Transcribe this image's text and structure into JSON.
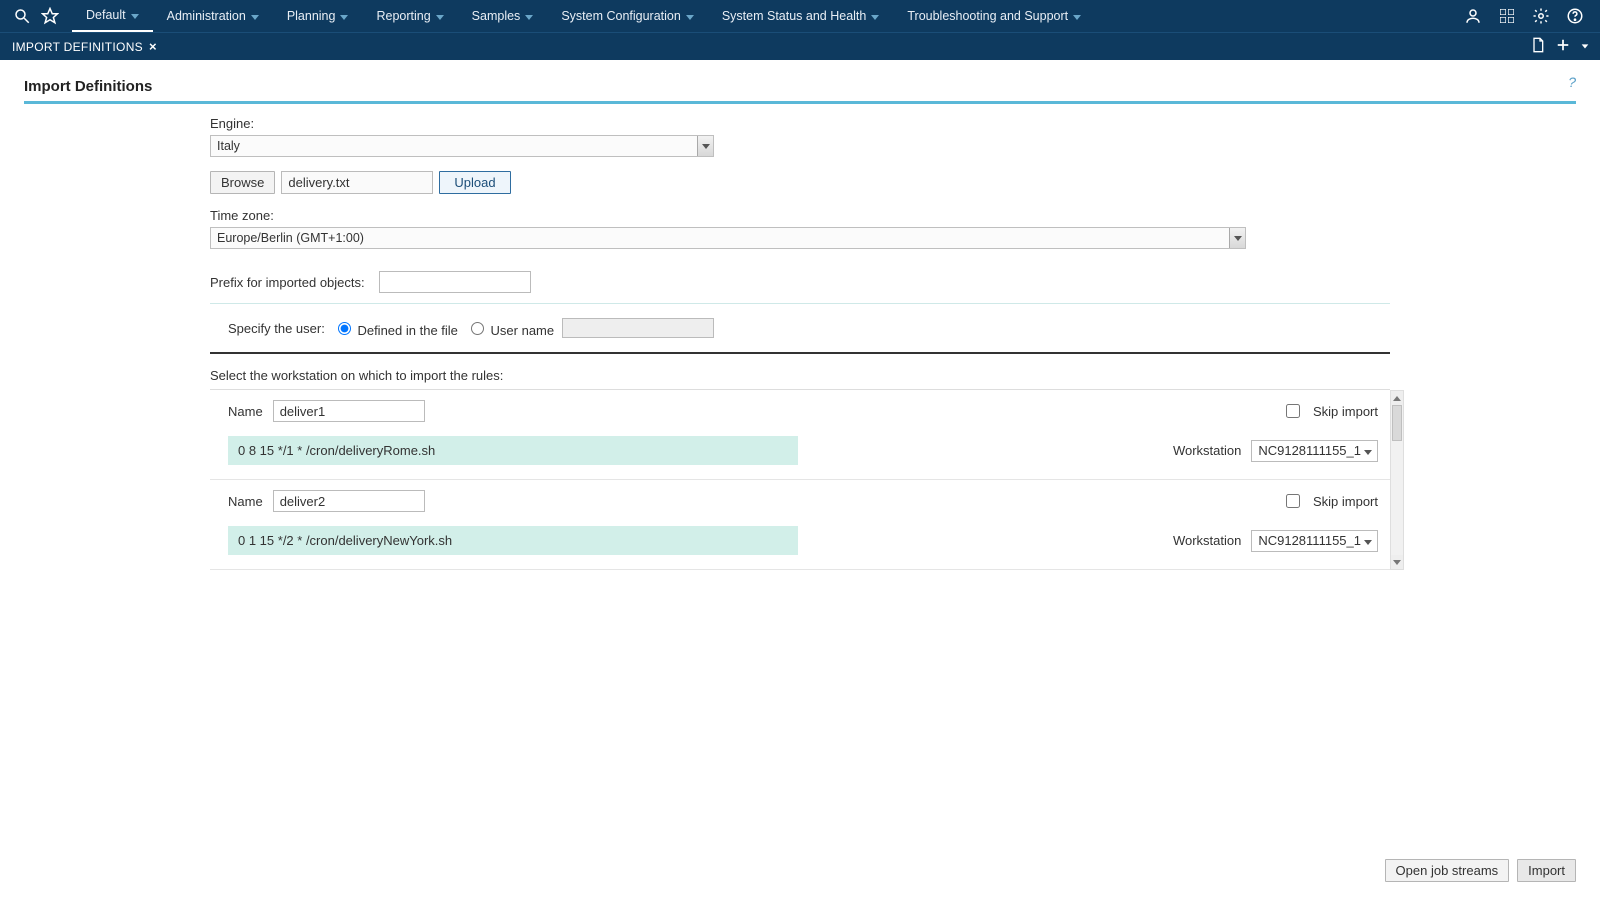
{
  "nav": {
    "menus": [
      "Default",
      "Administration",
      "Planning",
      "Reporting",
      "Samples",
      "System Configuration",
      "System Status and Health",
      "Troubleshooting and Support"
    ]
  },
  "tab": {
    "title": "IMPORT DEFINITIONS"
  },
  "page": {
    "title": "Import Definitions",
    "help": "?"
  },
  "form": {
    "engine_label": "Engine:",
    "engine_value": "Italy",
    "browse_label": "Browse",
    "file_name": "delivery.txt",
    "upload_label": "Upload",
    "timezone_label": "Time zone:",
    "timezone_value": "Europe/Berlin (GMT+1:00)",
    "prefix_label": "Prefix for imported objects:",
    "prefix_value": "",
    "specify_user_label": "Specify the user:",
    "radio_defined": "Defined in the file",
    "radio_username": "User name",
    "username_value": ""
  },
  "rules": {
    "header": "Select the workstation on which to import the rules:",
    "name_label": "Name",
    "skip_label": "Skip import",
    "workstation_label": "Workstation",
    "items": [
      {
        "name": "deliver1",
        "cron": "0 8 15 */1 * /cron/deliveryRome.sh",
        "skip": false,
        "workstation": "NC9128111155_1"
      },
      {
        "name": "deliver2",
        "cron": "0 1 15 */2 * /cron/deliveryNewYork.sh",
        "skip": false,
        "workstation": "NC9128111155_1"
      }
    ]
  },
  "footer": {
    "open_streams": "Open job streams",
    "import": "Import"
  }
}
